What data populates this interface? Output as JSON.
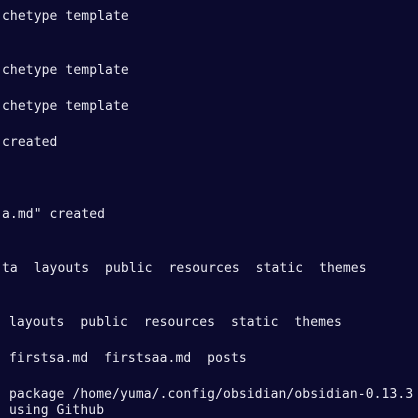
{
  "terminal": {
    "lines": [
      "chetype template",
      "chetype template",
      "chetype template",
      "created",
      "a.md\" created",
      "ta  layouts  public  resources  static  themes",
      "layouts  public  resources  static  themes",
      "firstsa.md  firstsaa.md  posts",
      "package /home/yuma/.config/obsidian/obsidian-0.13.3",
      "using Github"
    ]
  },
  "colors": {
    "background": "#0b0a2e",
    "text": "#e8e8f0"
  }
}
